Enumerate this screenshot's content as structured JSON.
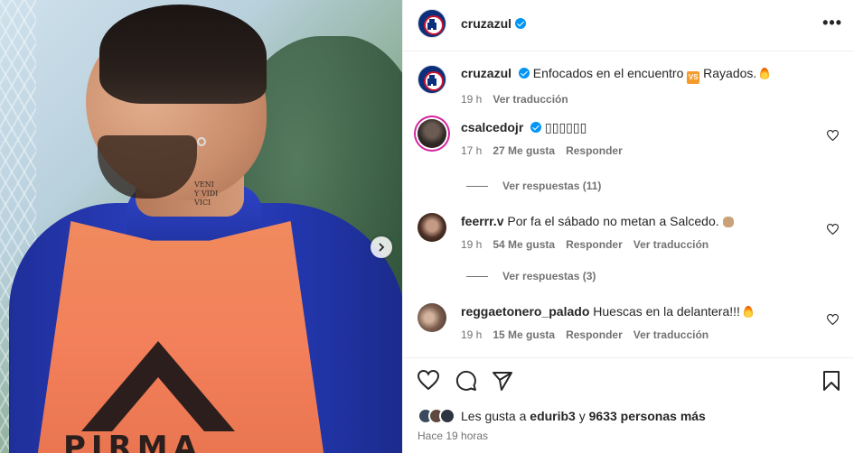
{
  "post": {
    "username": "cruzazul",
    "more_label": "•••",
    "caption_text": "Enfocados en el encuentro",
    "caption_vs": "VS",
    "caption_tail": "Rayados.",
    "caption_time": "19 h",
    "caption_translate": "Ver traducción",
    "photo_brand": "PIRMA",
    "photo_tattoo": "VENI\nY VIDI\nVICI"
  },
  "comments": [
    {
      "username": "csalcedojr",
      "text": "▯▯▯▯▯▯",
      "time": "17 h",
      "likes": "27 Me gusta",
      "reply": "Responder",
      "replies": "Ver respuestas (11)"
    },
    {
      "username": "feerrr.v",
      "text": "Por fa el sábado no metan a Salcedo.",
      "time": "19 h",
      "likes": "54 Me gusta",
      "reply": "Responder",
      "translate": "Ver traducción",
      "replies": "Ver respuestas (3)"
    },
    {
      "username": "reggaetonero_palado",
      "text": "Huescas en la delantera!!!",
      "time": "19 h",
      "likes": "15 Me gusta",
      "reply": "Responder",
      "translate": "Ver traducción"
    }
  ],
  "footer": {
    "likes_prefix": "Les gusta a",
    "likes_user": "edurib3",
    "likes_mid": "y",
    "likes_count": "9633 personas más",
    "timestamp": "Hace 19 horas"
  },
  "colors": {
    "verified": "#0095f6",
    "secondary_text": "#737373",
    "brand_navy": "#0b2f7d"
  }
}
